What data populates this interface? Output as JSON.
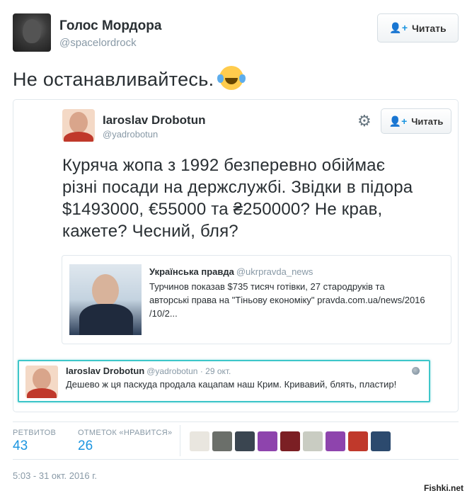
{
  "tweet": {
    "author_name": "Голос Мордора",
    "author_handle": "@spacelordrock",
    "follow_label": "Читать",
    "text": "Не останавливайтесь.",
    "emoji": "face-with-tears-of-joy",
    "timestamp": "5:03 - 31 окт. 2016 г."
  },
  "embedded": {
    "author_name": "Iaroslav Drobotun",
    "author_handle": "@yadrobotun",
    "follow_label": "Читать",
    "text_lines": [
      "Куряча жопа з 1992 безперевно обіймає",
      "різні посади на держслужбі. Звідки в підора",
      "$1493000, €55000 та ₴250000? Не крав,",
      "кажете? Чесний, бля?"
    ],
    "quote": {
      "source": "Українська правда",
      "handle": "@ukrpravda_news",
      "text_lines": [
        "Турчинов показав $735 тисяч готівки, 27 стародруків та",
        "авторські права на \"Тіньову економіку\" pravda.com.ua/news/2016",
        "/10/2..."
      ]
    },
    "reply": {
      "author_name": "Iaroslav Drobotun",
      "meta": "@yadrobotun · 29 окт.",
      "text": "Дешево ж ця паскуда продала кацапам наш Крим. Кривавий, блять, пластир!"
    }
  },
  "stats": {
    "retweets_label": "РЕТВИТОВ",
    "retweets_value": "43",
    "likes_label": "ОТМЕТОК «НРАВИТСЯ»",
    "likes_value": "26",
    "liker_colors": [
      "#e9e6df",
      "#6b6f6a",
      "#3a4550",
      "#8e44ad",
      "#7b1f24",
      "#c9ccc2",
      "#8e44ad",
      "#c0392b",
      "#2c4a6e"
    ]
  },
  "watermark": "Fishki.net",
  "colors": {
    "accent": "#1b95e0",
    "muted": "#8899a6",
    "highlight_border": "#3ec6c9"
  }
}
